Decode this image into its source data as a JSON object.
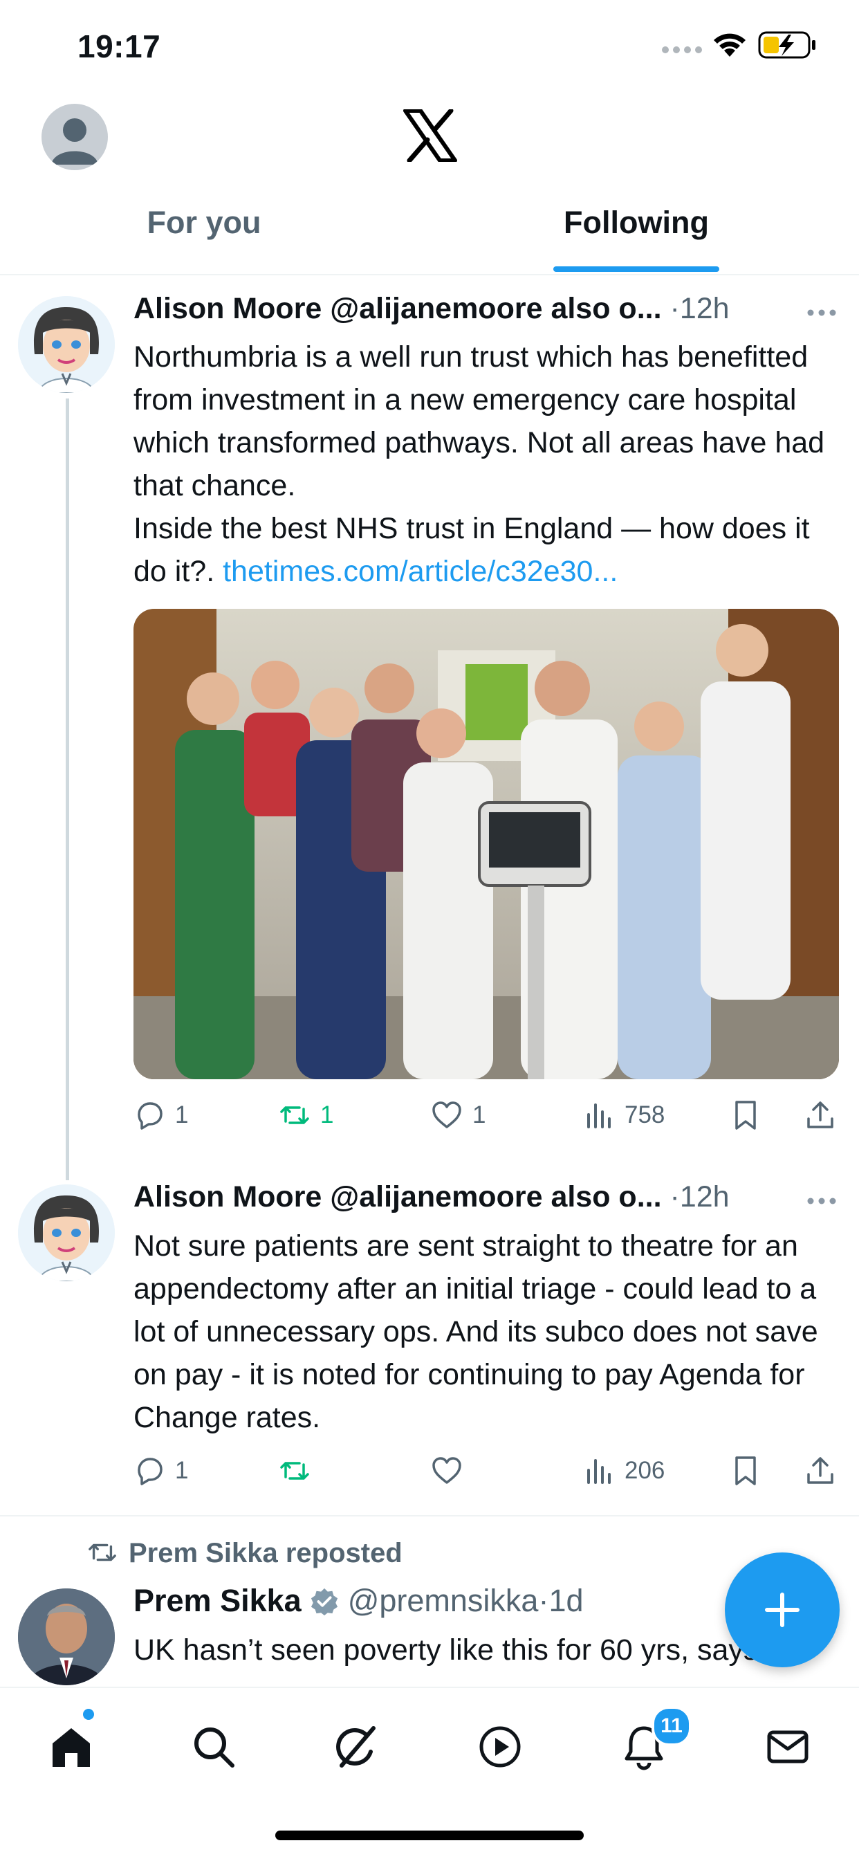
{
  "status_bar": {
    "time": "19:17"
  },
  "header": {
    "tabs": [
      {
        "label": "For you",
        "active": false
      },
      {
        "label": "Following",
        "active": true
      }
    ]
  },
  "tweets": [
    {
      "name": "Alison Moore",
      "handle": "@alijanemoore also o...",
      "separator": "·",
      "time": "12h",
      "body_lines": [
        "Northumbria is a well run trust which has benefitted from investment in a new emergency care hospital which transformed pathways. Not all areas have had that chance.",
        "Inside the best NHS trust in England — how does it do it?."
      ],
      "link": "thetimes.com/article/c32e30...",
      "stats": {
        "replies": "1",
        "reposts": "1",
        "likes": "1",
        "views": "758"
      }
    },
    {
      "name": "Alison Moore",
      "handle": "@alijanemoore also o...",
      "separator": "·",
      "time": "12h",
      "body": "Not sure patients are sent straight to theatre for an appendectomy after an initial triage - could lead to a lot of unnecessary ops. And its subco does not save on pay - it is noted for continuing to pay Agenda for Change rates.",
      "stats": {
        "replies": "1",
        "reposts": "",
        "likes": "",
        "views": "206"
      }
    },
    {
      "reposted_by": "Prem Sikka reposted",
      "name": "Prem Sikka",
      "handle": "@premnsikka",
      "separator": "·",
      "time": "1d",
      "body": "UK hasn’t seen poverty like this for 60 yrs, says",
      "verified": true
    }
  ],
  "notifications_badge": "11",
  "colors": {
    "accent": "#1d9bf0",
    "repost_green": "#00ba7c",
    "secondary_text": "#536471"
  },
  "icons": [
    "home-icon",
    "search-icon",
    "grok-icon",
    "video-icon",
    "bell-icon",
    "mail-icon",
    "compose-plus-icon"
  ]
}
